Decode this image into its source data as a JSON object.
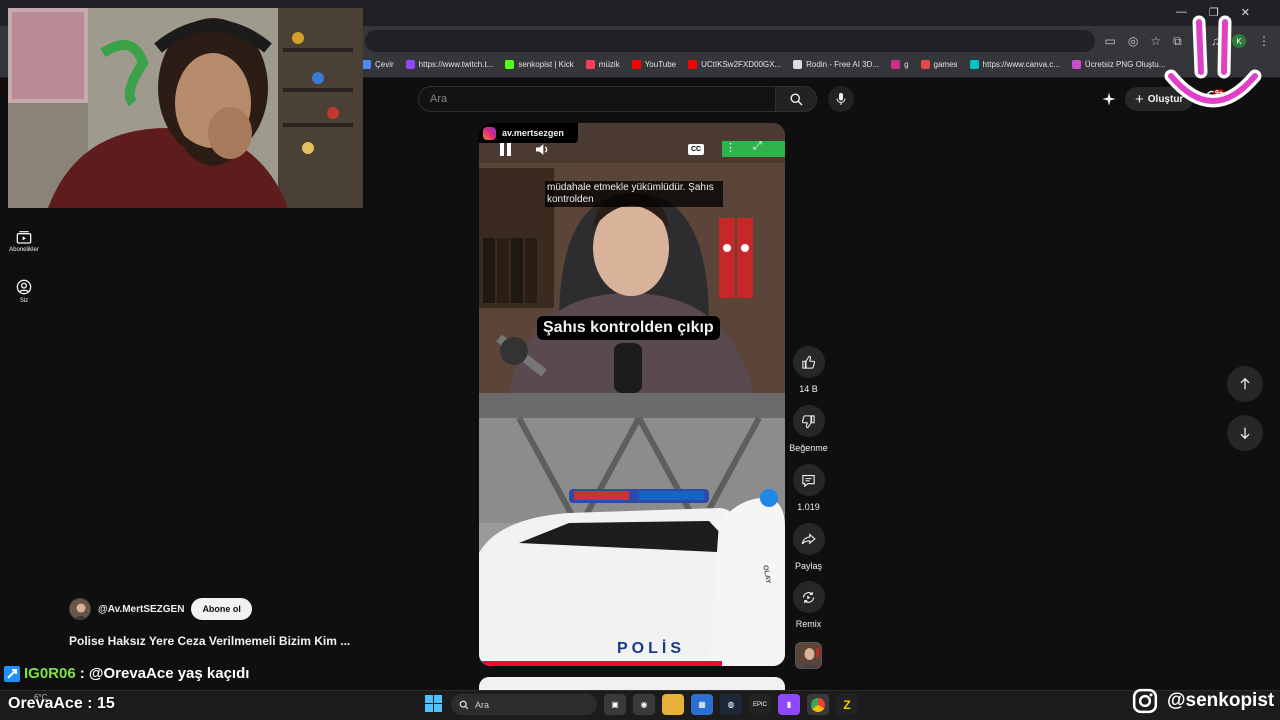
{
  "browser": {
    "bookmarks": [
      {
        "label": "Çevir",
        "color": "#4c8bf5"
      },
      {
        "label": "https://www.twitch.t...",
        "color": "#9146ff"
      },
      {
        "label": "senkopist | Kick",
        "color": "#53fc18"
      },
      {
        "label": "müzik",
        "color": "#ff3b5c"
      },
      {
        "label": "YouTube",
        "color": "#ff0000"
      },
      {
        "label": "UCtIKSw2FXD00GX...",
        "color": "#ff0000"
      },
      {
        "label": "Rodin - Free AI 3D...",
        "color": "#dddddd"
      },
      {
        "label": "g",
        "color": "#d12c8a"
      },
      {
        "label": "games",
        "color": "#e04a4a"
      },
      {
        "label": "https://www.canva.c...",
        "color": "#00c4cc"
      },
      {
        "label": "Ücretsiz PNG Oluştu...",
        "color": "#c94fd1"
      }
    ],
    "extension_badge": "K"
  },
  "youtube": {
    "search_placeholder": "Ara",
    "create_label": "Oluştur",
    "notification_count": "9+",
    "nav": {
      "subscriptions_label": "Abonelikler",
      "you_label": "Siz"
    }
  },
  "short": {
    "uploader_tag": "av.mertsezgen",
    "caption_small": "müdahale etmekle yükümlüdür. Şahıs kontrolden",
    "caption_big": "Şahıs kontrolden çıkıp",
    "car_text": "POLİS",
    "vest_text": "OLAY",
    "channel_name": "@Av.MertSEZGEN",
    "subscribe_label": "Abone ol",
    "title": "Polise Haksız Yere Ceza Verilmemeli Bizim Kim ...",
    "actions": {
      "like_count": "14 B",
      "dislike_label": "Beğenme",
      "comment_count": "1.019",
      "share_label": "Paylaş",
      "remix_label": "Remix"
    }
  },
  "overlay": {
    "chat_user": "IG0R06",
    "chat_message": ": @OrevaAce yaş kaçıdı",
    "counter_text": "OrevaAce : 15",
    "instagram_handle": "@senkopist"
  },
  "taskbar": {
    "search_placeholder": "Ara",
    "weather": "6°C",
    "epic_label": "EPIC"
  }
}
